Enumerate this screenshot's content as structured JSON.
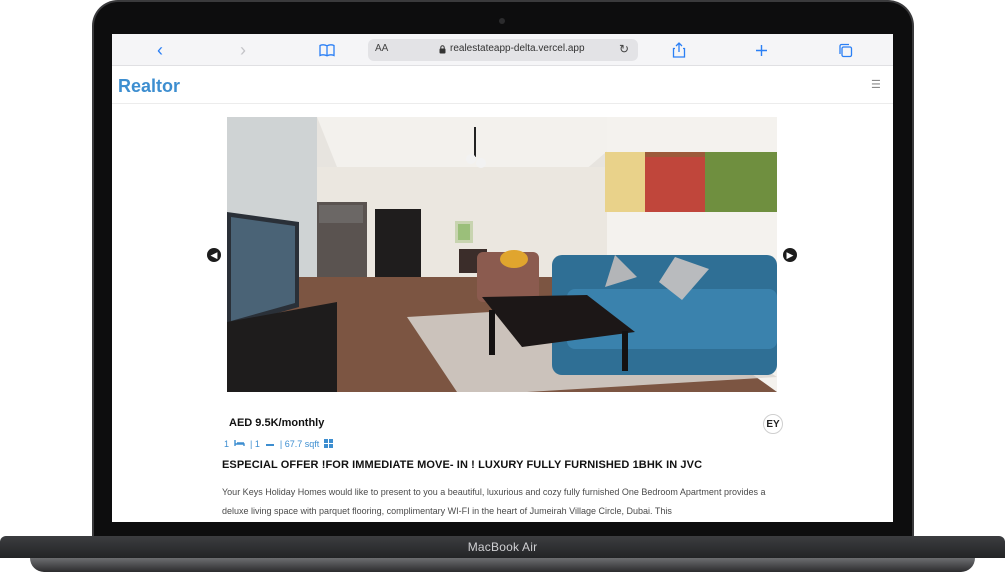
{
  "device": {
    "label": "MacBook Air"
  },
  "browser": {
    "text_size_label": "AA",
    "url": "realestateapp-delta.vercel.app",
    "icons": [
      "back-icon",
      "forward-icon",
      "bookmarks-icon",
      "lock-icon",
      "reload-icon",
      "share-icon",
      "new-tab-icon",
      "tabs-icon"
    ]
  },
  "site": {
    "brand": "Realtor",
    "menu_icon": "hamburger-icon"
  },
  "listing": {
    "price": "AED 9.5K/monthly",
    "rooms": "1",
    "baths": "| 1",
    "area": "| 67.7 sqft",
    "agency_logo_text": "EY",
    "title": "ESPECIAL OFFER !FOR IMMEDIATE MOVE- IN ! LUXURY FULLY FURNISHED 1BHK IN JVC",
    "description": "Your Keys Holiday Homes would like to present to you a beautiful, luxurious and cozy fully furnished One Bedroom Apartment provides a deluxe living space with parquet flooring, complimentary WI-FI in the heart of Jumeirah Village Circle, Dubai. This"
  },
  "colors": {
    "accent": "#3d8ed0",
    "safari_blue": "#2a7ff5",
    "sofa": "#2f6f95"
  }
}
